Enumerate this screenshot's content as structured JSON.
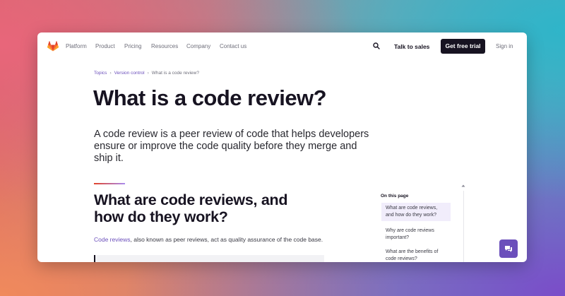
{
  "nav": {
    "links": [
      "Platform",
      "Product",
      "Pricing",
      "Resources",
      "Company",
      "Contact us"
    ],
    "talk_to_sales": "Talk to sales",
    "get_free_trial": "Get free trial",
    "sign_in": "Sign in"
  },
  "breadcrumb": {
    "items": [
      "Topics",
      "Version control"
    ],
    "current": "What is a code review?"
  },
  "main": {
    "title": "What is a code review?",
    "intro": "A code review is a peer review of code that helps developers ensure or improve the code quality before they merge and ship it.",
    "section_title": "What are code reviews, and how do they work?",
    "body_link": "Code reviews",
    "body_rest": ", also known as peer reviews, act as quality assurance of the code base."
  },
  "toc": {
    "heading": "On this page",
    "items": [
      "What are code reviews, and how do they work?",
      "Why are code reviews important?",
      "What are the benefits of code reviews?"
    ]
  },
  "colors": {
    "brand_dark": "#171321",
    "accent_purple": "#6b4fbb",
    "logo_orange": "#e24329"
  },
  "icons": {
    "logo": "gitlab-tanuki-icon",
    "search": "search-icon",
    "chat": "chat-icon",
    "scroll_up": "chevron-up-icon"
  }
}
